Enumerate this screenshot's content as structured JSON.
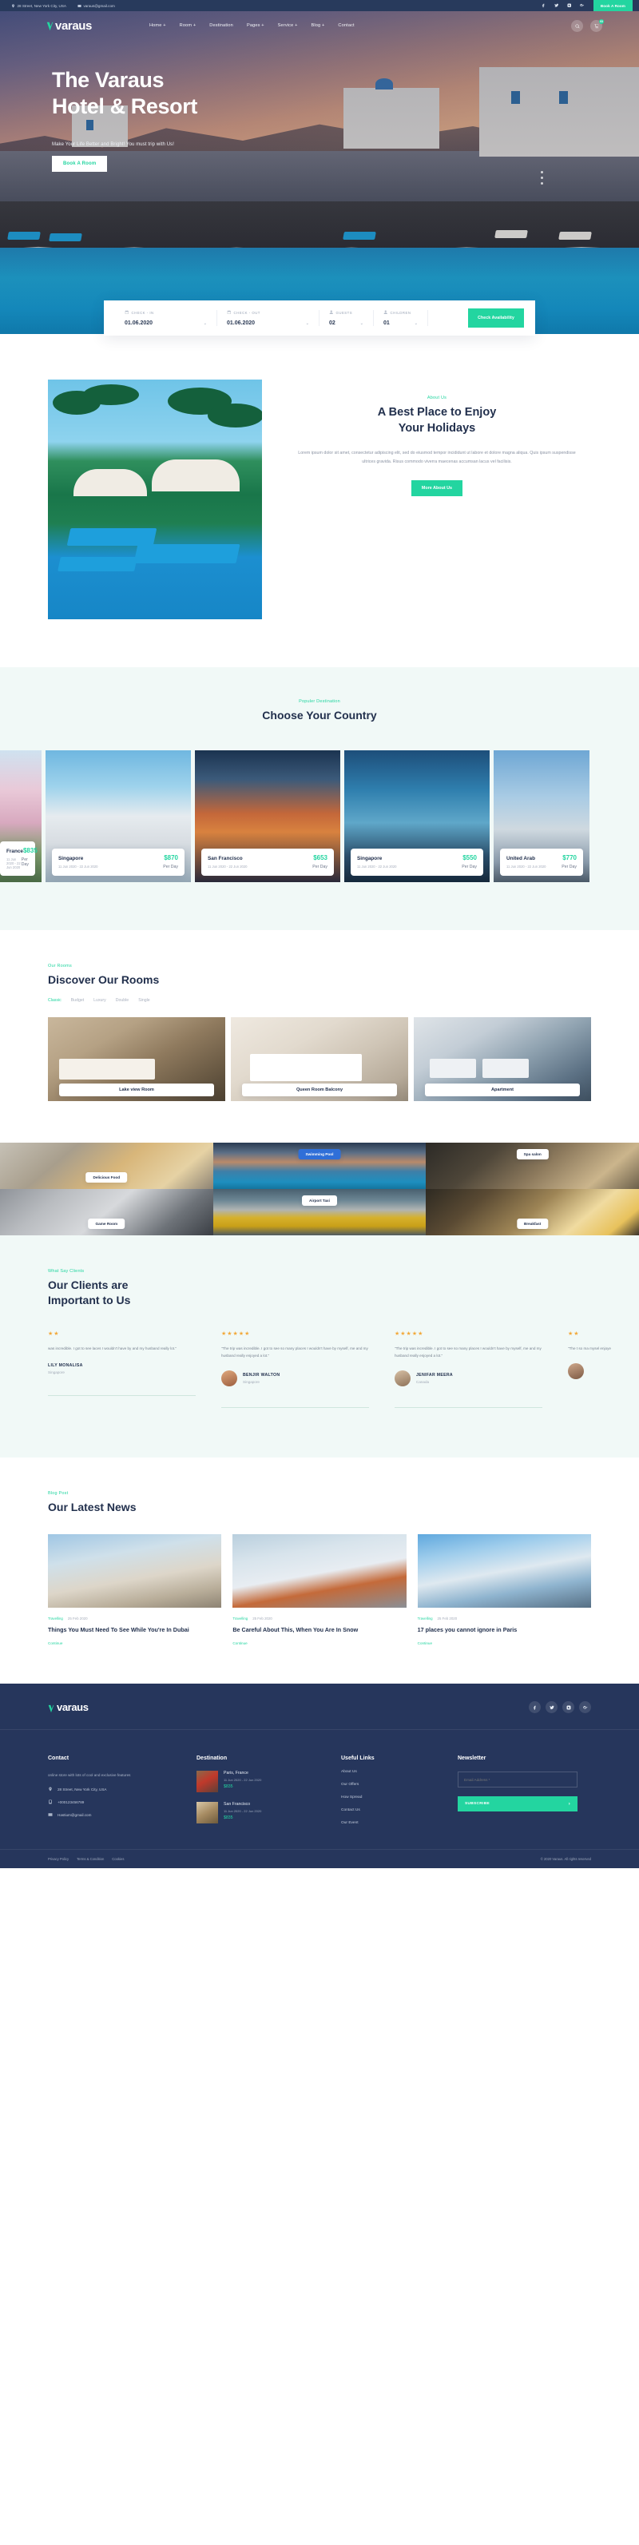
{
  "topbar": {
    "address": "28 Street, New York City, USA",
    "email": "varaus@gmail.com",
    "book_label": "Book A Room",
    "socials": [
      "facebook-icon",
      "twitter-icon",
      "instagram-icon",
      "google-plus-icon"
    ]
  },
  "brand": {
    "name": "varaus"
  },
  "nav": {
    "items": [
      {
        "label": "Home +"
      },
      {
        "label": "Room +"
      },
      {
        "label": "Destination"
      },
      {
        "label": "Pages +"
      },
      {
        "label": "Service +"
      },
      {
        "label": "Blog +"
      },
      {
        "label": "Contact"
      }
    ],
    "cart_count": "03"
  },
  "hero": {
    "title_line1": "The Varaus",
    "title_line2": "Hotel & Resort",
    "subtitle": "Make Your Life Better and Bright! You must trip with Us!",
    "button": "Book A Room"
  },
  "booking": {
    "checkin": {
      "label": "CHECK - IN",
      "value": "01.06.2020"
    },
    "checkout": {
      "label": "CHECK - OUT",
      "value": "01.06.2020"
    },
    "guests": {
      "label": "GUESTS",
      "value": "02"
    },
    "children": {
      "label": "CHILDREN",
      "value": "01"
    },
    "cta": "Check Availability"
  },
  "about": {
    "eyebrow": "About Us",
    "title_line1": "A Best Place to Enjoy",
    "title_line2": "Your Holidays",
    "paragraph": "Lorem ipsum dolor sit amet, consectetur adipiscing elit, sed do eiusmod tempor incididunt ut labore et dolore magna aliqua. Quis ipsum suspendisse ultrices gravida. Risus commodo viverra maecenas accumsan lacus vel facilisis.",
    "button": "More About Us"
  },
  "destinations": {
    "eyebrow": "Populer Destination",
    "title": "Choose Your Country",
    "per_day": "Per Day",
    "cards": [
      {
        "name": "France",
        "date": "11 Jun 2020 - 22 Jun 2020",
        "price": "$835",
        "per": "Per Day"
      },
      {
        "name": "Singapore",
        "date": "11 Jun 2020 - 22 Jun 2020",
        "price": "$870",
        "per": "Per Day"
      },
      {
        "name": "San Francisco",
        "date": "11 Jun 2020 - 22 Jun 2020",
        "price": "$653",
        "per": "Per Day"
      },
      {
        "name": "Singapore",
        "date": "11 Jun 2020 - 22 Jun 2020",
        "price": "$550",
        "per": "Per Day"
      },
      {
        "name": "United Arab",
        "date": "11 Jun 2020 - 22 Jun 2020",
        "price": "$770",
        "per": "Per Day"
      }
    ]
  },
  "rooms": {
    "eyebrow": "Our Rooms",
    "title": "Discover Our Rooms",
    "tabs": [
      {
        "label": "Classic",
        "active": true
      },
      {
        "label": "Budget",
        "active": false
      },
      {
        "label": "Luxury",
        "active": false
      },
      {
        "label": "Double",
        "active": false
      },
      {
        "label": "Single",
        "active": false
      }
    ],
    "cards": [
      {
        "label": "Lake view Room"
      },
      {
        "label": "Queen Room Balcony"
      },
      {
        "label": "Apartment"
      }
    ]
  },
  "services": {
    "items": [
      {
        "label": "Delicious Food",
        "position": "bottom",
        "style": "white"
      },
      {
        "label": "Swimming Pool",
        "position": "top",
        "style": "blue"
      },
      {
        "label": "Spa salon",
        "position": "top",
        "style": "white"
      },
      {
        "label": "Game Room",
        "position": "bottom",
        "style": "white"
      },
      {
        "label": "Airport Taxi",
        "position": "top",
        "style": "white"
      },
      {
        "label": "Breakfast",
        "position": "bottom",
        "style": "white"
      }
    ]
  },
  "testimonials": {
    "eyebrow": "What Say Clients",
    "title_line1": "Our Clients are",
    "title_line2": "Important to Us",
    "items": [
      {
        "stars": "★★",
        "quote": "was incredible. I got to see laces I wouldn't have by  and my husband really lot.\"",
        "name": "LILY MONALISA",
        "location": "Singapore"
      },
      {
        "stars": "★★★★★",
        "quote": "\"The trip was incredible. I got to see so many places I wouldn't have by myself, me and my husband really enjoyed a lot.\"",
        "name": "BENJIR WALTON",
        "location": "Singapore"
      },
      {
        "stars": "★★★★★",
        "quote": "\"The trip was incredible. I got to see so many places I wouldn't have by myself, me and my husband really enjoyed a lot.\"",
        "name": "JENIFAR MEERA",
        "location": "Canada"
      },
      {
        "stars": "★★",
        "quote": "\"The t so ma mysel enjoye",
        "name": "",
        "location": ""
      }
    ]
  },
  "blog": {
    "eyebrow": "Blog Post",
    "title": "Our Latest News",
    "posts": [
      {
        "tag": "Travelling",
        "date": "25 Feb 2020",
        "title": "Things You Must Need To See While You're In Dubai",
        "more": "Continue"
      },
      {
        "tag": "Travelling",
        "date": "25 Feb 2020",
        "title": "Be Careful About This, When You Are In Snow",
        "more": "Continue"
      },
      {
        "tag": "Travelling",
        "date": "25 Feb 2020",
        "title": "17 places you cannot ignore in Paris",
        "more": "Continue"
      }
    ]
  },
  "footer": {
    "brand": "varaus",
    "socials": [
      "facebook-icon",
      "twitter-icon",
      "instagram-icon",
      "google-plus-icon"
    ],
    "contact": {
      "title": "Contact",
      "description": "online store with lots of cool and exclusive features",
      "address": "28 Street, New York City, USA",
      "phone": "+000123456789",
      "email": "Hastium@gmail.com"
    },
    "destination": {
      "title": "Destination",
      "items": [
        {
          "name": "Paris, France",
          "date": "11 Jun 2020 - 22 Jun 2020",
          "price": "$835"
        },
        {
          "name": "San Francisco",
          "date": "11 Jun 2020 - 22 Jun 2020",
          "price": "$835"
        }
      ]
    },
    "useful_links": {
      "title": "Useful Links",
      "items": [
        "About Us",
        "Our Offers",
        "How Spread",
        "Contact Us",
        "Our Event"
      ]
    },
    "newsletter": {
      "title": "Newsletter",
      "placeholder": "Email Address *",
      "button": "SUBSCRIBE"
    },
    "bottom": {
      "links": [
        "Privacy Policy",
        "Terms & Condition",
        "Cookies"
      ],
      "copyright": "© 2020 Varaus. All rights reserved"
    }
  },
  "colors": {
    "accent": "#23d5a0",
    "dark": "#26365c",
    "heading": "#22304d"
  }
}
